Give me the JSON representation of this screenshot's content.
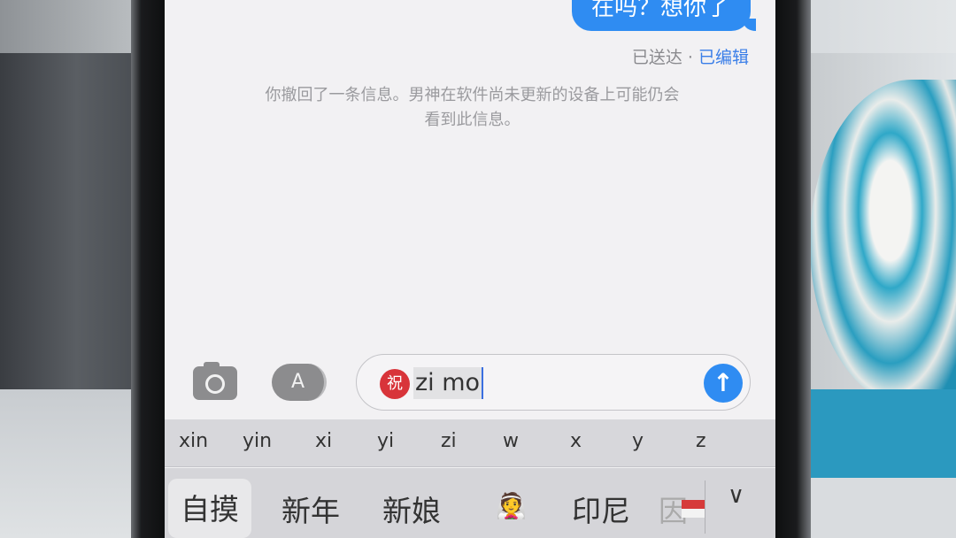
{
  "conversation": {
    "last_message": "在吗？想你了",
    "status_delivered": "已送达",
    "status_separator": "·",
    "status_edited": "已编辑",
    "notice_line1": "你撤回了一条信息。男神在软件尚未更新的设备上可能仍会",
    "notice_line2": "看到此信息。"
  },
  "input_bar": {
    "camera_icon": "camera-icon",
    "apps_icon": "app-store-icon",
    "apps_glyph": "A",
    "emoji_glyph": "祝",
    "typed_text": "zi mo",
    "send_glyph": "↑"
  },
  "keyboard": {
    "pinyin_options": [
      "xin",
      "yin",
      "xi",
      "yi",
      "zi",
      "w",
      "x",
      "y",
      "z"
    ],
    "candidates": [
      "自摸",
      "新年",
      "新娘",
      "👰",
      "印尼",
      "因"
    ],
    "expand_glyph": "∨"
  },
  "colors": {
    "accent": "#2f8cf2",
    "edited_link": "#3a7ee8",
    "emoji_red": "#d8343a"
  }
}
